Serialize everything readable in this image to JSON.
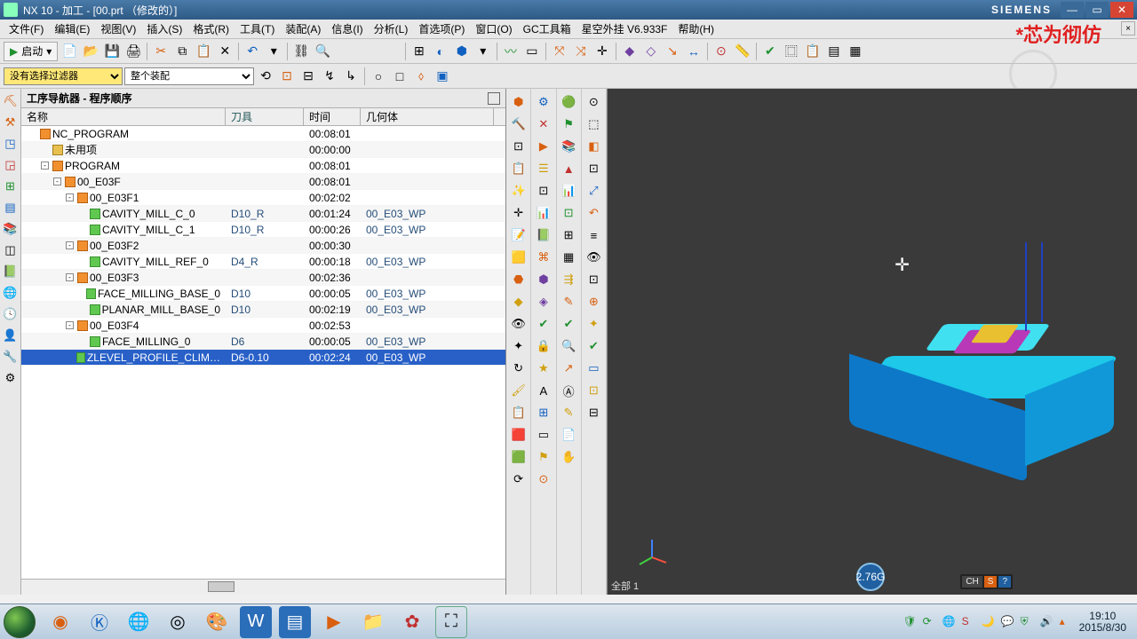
{
  "title": "NX 10 - 加工 - [00.prt （修改的）]",
  "brand": "SIEMENS",
  "watermark": "*芯为彻仿",
  "menus": [
    "文件(F)",
    "编辑(E)",
    "视图(V)",
    "插入(S)",
    "格式(R)",
    "工具(T)",
    "装配(A)",
    "信息(I)",
    "分析(L)",
    "首选项(P)",
    "窗口(O)",
    "GC工具箱",
    "星空外挂 V6.933F",
    "帮助(H)"
  ],
  "launch_label": "启动",
  "filter_label": "没有选择过滤器",
  "assembly_label": "整个装配",
  "nav_title": "工序导航器 - 程序顺序",
  "cols": {
    "name": "名称",
    "tool": "刀具",
    "time": "时间",
    "geo": "几何体"
  },
  "tree": [
    {
      "d": 0,
      "exp": "",
      "ic": "prog",
      "name": "NC_PROGRAM",
      "tool": "",
      "time": "00:08:01",
      "geo": ""
    },
    {
      "d": 1,
      "exp": "",
      "ic": "folder",
      "name": "未用项",
      "tool": "",
      "time": "00:00:00",
      "geo": ""
    },
    {
      "d": 1,
      "exp": "-",
      "ic": "prog",
      "name": "PROGRAM",
      "tool": "",
      "time": "00:08:01",
      "geo": ""
    },
    {
      "d": 2,
      "exp": "-",
      "ic": "prog",
      "name": "00_E03F",
      "tool": "",
      "time": "00:08:01",
      "geo": ""
    },
    {
      "d": 3,
      "exp": "-",
      "ic": "prog",
      "name": "00_E03F1",
      "tool": "",
      "time": "00:02:02",
      "geo": ""
    },
    {
      "d": 4,
      "exp": "",
      "ic": "check",
      "name": "CAVITY_MILL_C_0",
      "tool": "D10_R",
      "time": "00:01:24",
      "geo": "00_E03_WP"
    },
    {
      "d": 4,
      "exp": "",
      "ic": "check",
      "name": "CAVITY_MILL_C_1",
      "tool": "D10_R",
      "time": "00:00:26",
      "geo": "00_E03_WP"
    },
    {
      "d": 3,
      "exp": "-",
      "ic": "prog",
      "name": "00_E03F2",
      "tool": "",
      "time": "00:00:30",
      "geo": ""
    },
    {
      "d": 4,
      "exp": "",
      "ic": "check",
      "name": "CAVITY_MILL_REF_0",
      "tool": "D4_R",
      "time": "00:00:18",
      "geo": "00_E03_WP"
    },
    {
      "d": 3,
      "exp": "-",
      "ic": "prog",
      "name": "00_E03F3",
      "tool": "",
      "time": "00:02:36",
      "geo": ""
    },
    {
      "d": 4,
      "exp": "",
      "ic": "check",
      "name": "FACE_MILLING_BASE_0",
      "tool": "D10",
      "time": "00:00:05",
      "geo": "00_E03_WP"
    },
    {
      "d": 4,
      "exp": "",
      "ic": "check",
      "name": "PLANAR_MILL_BASE_0",
      "tool": "D10",
      "time": "00:02:19",
      "geo": "00_E03_WP"
    },
    {
      "d": 3,
      "exp": "-",
      "ic": "prog",
      "name": "00_E03F4",
      "tool": "",
      "time": "00:02:53",
      "geo": ""
    },
    {
      "d": 4,
      "exp": "",
      "ic": "check",
      "name": "FACE_MILLING_0",
      "tool": "D6",
      "time": "00:00:05",
      "geo": "00_E03_WP"
    },
    {
      "d": 4,
      "exp": "",
      "ic": "check",
      "name": "ZLEVEL_PROFILE_CLIM…",
      "tool": "D6-0.10",
      "time": "00:02:24",
      "geo": "00_E03_WP",
      "sel": true
    }
  ],
  "view_foot": "全部 1",
  "gauge": "2.76G",
  "lang": "CH",
  "clock_time": "19:10",
  "clock_date": "2015/8/30"
}
